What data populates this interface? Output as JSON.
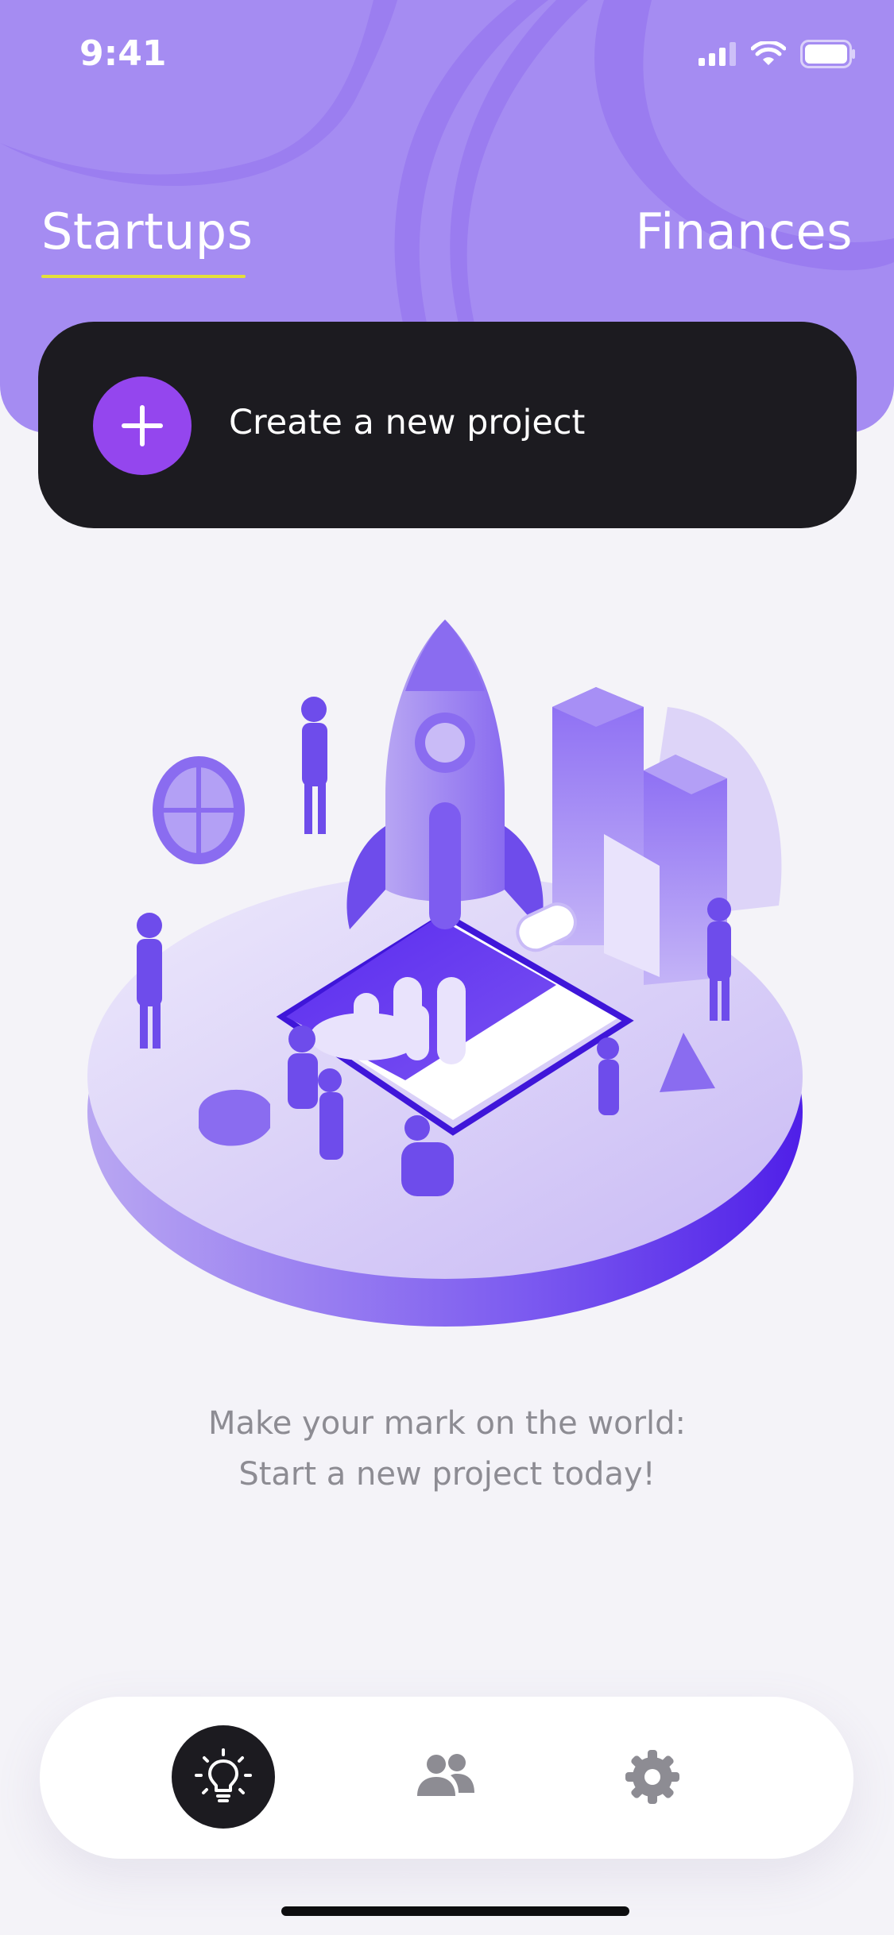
{
  "status_bar": {
    "time": "9:41"
  },
  "tabs": {
    "startups": "Startups",
    "finances": "Finances",
    "active": "Startups"
  },
  "create_card": {
    "label": "Create a new project"
  },
  "empty_state": {
    "line1": "Make your mark on the world:",
    "line2": "Start a new project today!"
  },
  "tab_bar": {
    "items": [
      {
        "icon": "lightbulb-icon",
        "active": true
      },
      {
        "icon": "people-icon",
        "active": false
      },
      {
        "icon": "gear-icon",
        "active": false
      }
    ]
  },
  "colors": {
    "header": "#a58cf2",
    "accent": "#9446ee",
    "card": "#1c1b20",
    "underline": "#e4e03a"
  }
}
